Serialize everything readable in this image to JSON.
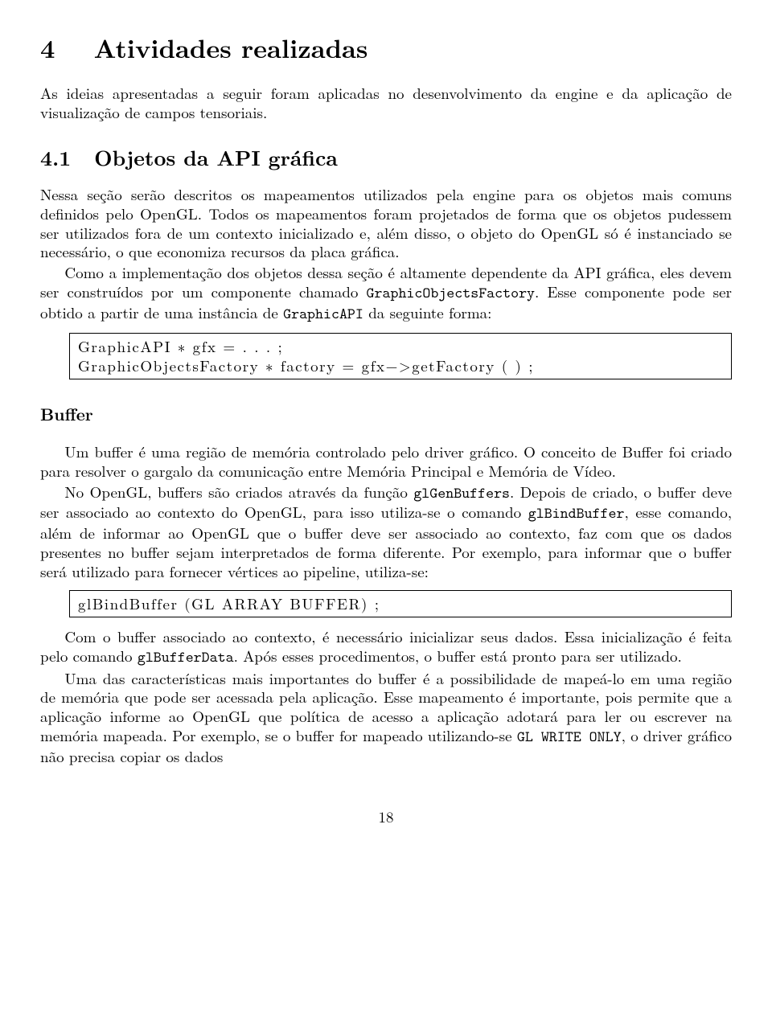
{
  "section": {
    "number": "4",
    "title": "Atividades realizadas",
    "intro": "As ideias apresentadas a seguir foram aplicadas no desenvolvimento da engine e da aplicação de visualização de campos tensoriais."
  },
  "subsection": {
    "number": "4.1",
    "title": "Objetos da API gráfica",
    "p1a": "Nessa seção serão descritos os mapeamentos utilizados pela engine para os objetos mais comuns definidos pelo OpenGL. Todos os mapeamentos foram projetados de forma que os objetos pudessem ser utilizados fora de um contexto inicializado e, além disso, o objeto do OpenGL só é instanciado se necessário, o que economiza recursos da placa gráfica.",
    "p2a": "Como a implementação dos objetos dessa seção é altamente dependente da API gráfica, eles devem ser construídos por um componente chamado ",
    "p2code": "GraphicObjectsFactory",
    "p2b": ". Esse componente pode ser obtido a partir de uma instância de ",
    "p2code2": "GraphicAPI",
    "p2c": " da seguinte forma:",
    "codebox1": "GraphicAPI ∗ gfx = . . . ;\nGraphicObjectsFactory ∗ factory = gfx−>getFactory ( ) ;"
  },
  "buffer": {
    "title": "Buffer",
    "p1": "Um buffer é uma região de memória controlado pelo driver gráfico. O conceito de Buffer foi criado para resolver o gargalo da comunicação entre Memória Principal e Memória de Vídeo.",
    "p2a": "No OpenGL, buffers são criados através da função ",
    "p2code": "glGenBuffers",
    "p2b": ". Depois de criado, o buffer deve ser associado ao contexto do OpenGL, para isso utiliza-se o comando ",
    "p2code2": "glBindBuffer",
    "p2c": ", esse comando, além de informar ao OpenGL que o buffer deve ser associado ao contexto, faz com que os dados presentes no buffer sejam interpretados de forma diferente. Por exemplo, para informar que o buffer será utilizado para fornecer vértices ao pipeline, utiliza-se:",
    "codebox2": "glBindBuffer (GL ARRAY BUFFER) ;",
    "p3a": "Com o buffer associado ao contexto, é necessário inicializar seus dados. Essa inicialização é feita pelo comando ",
    "p3code": "glBufferData",
    "p3b": ". Após esses procedimentos, o buffer está pronto para ser utilizado.",
    "p4a": "Uma das características mais importantes do buffer é a possibilidade de mapeá-lo em uma região de memória que pode ser acessada pela aplicação. Esse mapeamento é importante, pois permite que a aplicação informe ao OpenGL que política de acesso a aplicação adotará para ler ou escrever na memória mapeada. Por exemplo, se o buffer for mapeado utilizando-se ",
    "p4code": "GL WRITE ONLY",
    "p4b": ", o driver gráfico não precisa copiar os dados"
  },
  "page_number": "18"
}
